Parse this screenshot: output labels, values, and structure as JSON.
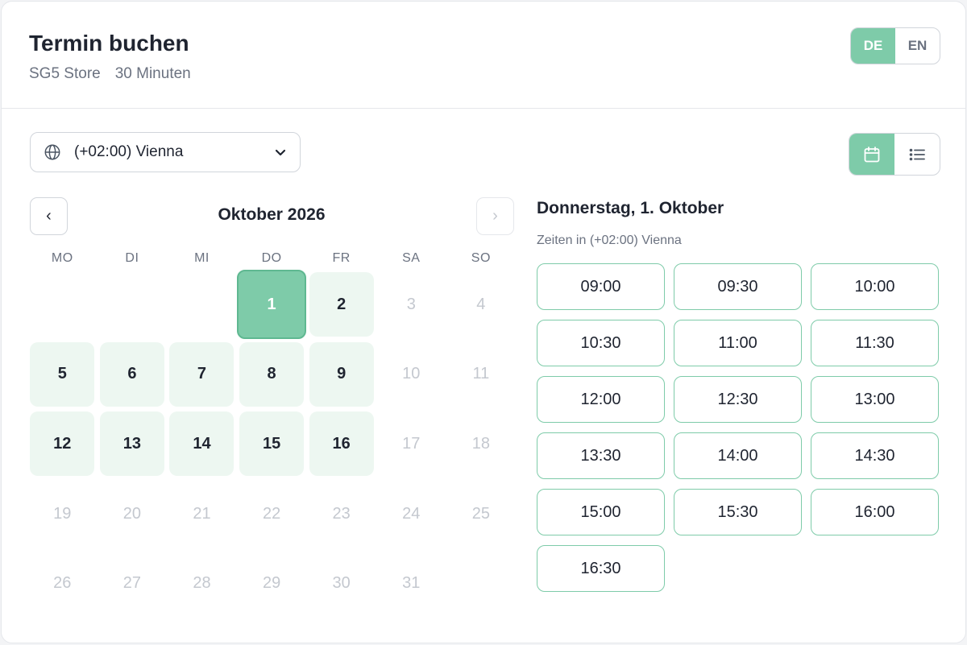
{
  "header": {
    "title": "Termin buchen",
    "store": "SG5 Store",
    "duration": "30 Minuten",
    "languages": [
      "DE",
      "EN"
    ],
    "active_language": "DE"
  },
  "timezone": {
    "label": "(+02:00) Vienna",
    "icon": "globe-icon"
  },
  "view_toggle": {
    "options": [
      "calendar-icon",
      "list-icon"
    ],
    "active": "calendar"
  },
  "calendar": {
    "month_label": "Oktober 2026",
    "prev_label": "‹",
    "next_label": "›",
    "weekdays": [
      "MO",
      "DI",
      "MI",
      "DO",
      "FR",
      "SA",
      "SO"
    ],
    "leading_blanks": 3,
    "selected_day": 1,
    "available_days": [
      1,
      2,
      5,
      6,
      7,
      8,
      9,
      12,
      13,
      14,
      15,
      16
    ],
    "days_in_month": 31
  },
  "slots_panel": {
    "date_title": "Donnerstag, 1. Oktober",
    "timezone_note": "Zeiten in (+02:00) Vienna",
    "times": [
      "09:00",
      "09:30",
      "10:00",
      "10:30",
      "11:00",
      "11:30",
      "12:00",
      "12:30",
      "13:00",
      "13:30",
      "14:00",
      "14:30",
      "15:00",
      "15:30",
      "16:00",
      "16:30"
    ]
  },
  "colors": {
    "accent": "#7ecba9",
    "available_bg": "#edf7f1",
    "disabled_text": "#c4c8cf"
  }
}
